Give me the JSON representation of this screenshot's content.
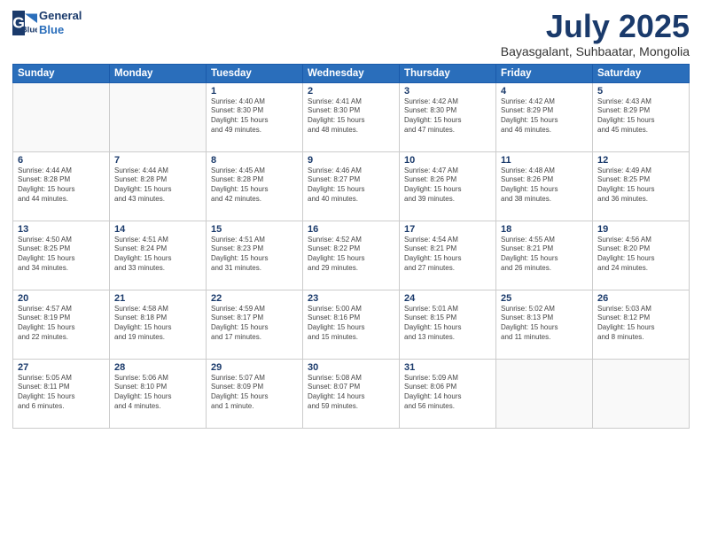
{
  "logo": {
    "line1": "General",
    "line2": "Blue"
  },
  "title": "July 2025",
  "location": "Bayasgalant, Suhbaatar, Mongolia",
  "days_of_week": [
    "Sunday",
    "Monday",
    "Tuesday",
    "Wednesday",
    "Thursday",
    "Friday",
    "Saturday"
  ],
  "weeks": [
    [
      {
        "day": "",
        "info": ""
      },
      {
        "day": "",
        "info": ""
      },
      {
        "day": "1",
        "info": "Sunrise: 4:40 AM\nSunset: 8:30 PM\nDaylight: 15 hours\nand 49 minutes."
      },
      {
        "day": "2",
        "info": "Sunrise: 4:41 AM\nSunset: 8:30 PM\nDaylight: 15 hours\nand 48 minutes."
      },
      {
        "day": "3",
        "info": "Sunrise: 4:42 AM\nSunset: 8:30 PM\nDaylight: 15 hours\nand 47 minutes."
      },
      {
        "day": "4",
        "info": "Sunrise: 4:42 AM\nSunset: 8:29 PM\nDaylight: 15 hours\nand 46 minutes."
      },
      {
        "day": "5",
        "info": "Sunrise: 4:43 AM\nSunset: 8:29 PM\nDaylight: 15 hours\nand 45 minutes."
      }
    ],
    [
      {
        "day": "6",
        "info": "Sunrise: 4:44 AM\nSunset: 8:28 PM\nDaylight: 15 hours\nand 44 minutes."
      },
      {
        "day": "7",
        "info": "Sunrise: 4:44 AM\nSunset: 8:28 PM\nDaylight: 15 hours\nand 43 minutes."
      },
      {
        "day": "8",
        "info": "Sunrise: 4:45 AM\nSunset: 8:28 PM\nDaylight: 15 hours\nand 42 minutes."
      },
      {
        "day": "9",
        "info": "Sunrise: 4:46 AM\nSunset: 8:27 PM\nDaylight: 15 hours\nand 40 minutes."
      },
      {
        "day": "10",
        "info": "Sunrise: 4:47 AM\nSunset: 8:26 PM\nDaylight: 15 hours\nand 39 minutes."
      },
      {
        "day": "11",
        "info": "Sunrise: 4:48 AM\nSunset: 8:26 PM\nDaylight: 15 hours\nand 38 minutes."
      },
      {
        "day": "12",
        "info": "Sunrise: 4:49 AM\nSunset: 8:25 PM\nDaylight: 15 hours\nand 36 minutes."
      }
    ],
    [
      {
        "day": "13",
        "info": "Sunrise: 4:50 AM\nSunset: 8:25 PM\nDaylight: 15 hours\nand 34 minutes."
      },
      {
        "day": "14",
        "info": "Sunrise: 4:51 AM\nSunset: 8:24 PM\nDaylight: 15 hours\nand 33 minutes."
      },
      {
        "day": "15",
        "info": "Sunrise: 4:51 AM\nSunset: 8:23 PM\nDaylight: 15 hours\nand 31 minutes."
      },
      {
        "day": "16",
        "info": "Sunrise: 4:52 AM\nSunset: 8:22 PM\nDaylight: 15 hours\nand 29 minutes."
      },
      {
        "day": "17",
        "info": "Sunrise: 4:54 AM\nSunset: 8:21 PM\nDaylight: 15 hours\nand 27 minutes."
      },
      {
        "day": "18",
        "info": "Sunrise: 4:55 AM\nSunset: 8:21 PM\nDaylight: 15 hours\nand 26 minutes."
      },
      {
        "day": "19",
        "info": "Sunrise: 4:56 AM\nSunset: 8:20 PM\nDaylight: 15 hours\nand 24 minutes."
      }
    ],
    [
      {
        "day": "20",
        "info": "Sunrise: 4:57 AM\nSunset: 8:19 PM\nDaylight: 15 hours\nand 22 minutes."
      },
      {
        "day": "21",
        "info": "Sunrise: 4:58 AM\nSunset: 8:18 PM\nDaylight: 15 hours\nand 19 minutes."
      },
      {
        "day": "22",
        "info": "Sunrise: 4:59 AM\nSunset: 8:17 PM\nDaylight: 15 hours\nand 17 minutes."
      },
      {
        "day": "23",
        "info": "Sunrise: 5:00 AM\nSunset: 8:16 PM\nDaylight: 15 hours\nand 15 minutes."
      },
      {
        "day": "24",
        "info": "Sunrise: 5:01 AM\nSunset: 8:15 PM\nDaylight: 15 hours\nand 13 minutes."
      },
      {
        "day": "25",
        "info": "Sunrise: 5:02 AM\nSunset: 8:13 PM\nDaylight: 15 hours\nand 11 minutes."
      },
      {
        "day": "26",
        "info": "Sunrise: 5:03 AM\nSunset: 8:12 PM\nDaylight: 15 hours\nand 8 minutes."
      }
    ],
    [
      {
        "day": "27",
        "info": "Sunrise: 5:05 AM\nSunset: 8:11 PM\nDaylight: 15 hours\nand 6 minutes."
      },
      {
        "day": "28",
        "info": "Sunrise: 5:06 AM\nSunset: 8:10 PM\nDaylight: 15 hours\nand 4 minutes."
      },
      {
        "day": "29",
        "info": "Sunrise: 5:07 AM\nSunset: 8:09 PM\nDaylight: 15 hours\nand 1 minute."
      },
      {
        "day": "30",
        "info": "Sunrise: 5:08 AM\nSunset: 8:07 PM\nDaylight: 14 hours\nand 59 minutes."
      },
      {
        "day": "31",
        "info": "Sunrise: 5:09 AM\nSunset: 8:06 PM\nDaylight: 14 hours\nand 56 minutes."
      },
      {
        "day": "",
        "info": ""
      },
      {
        "day": "",
        "info": ""
      }
    ]
  ]
}
